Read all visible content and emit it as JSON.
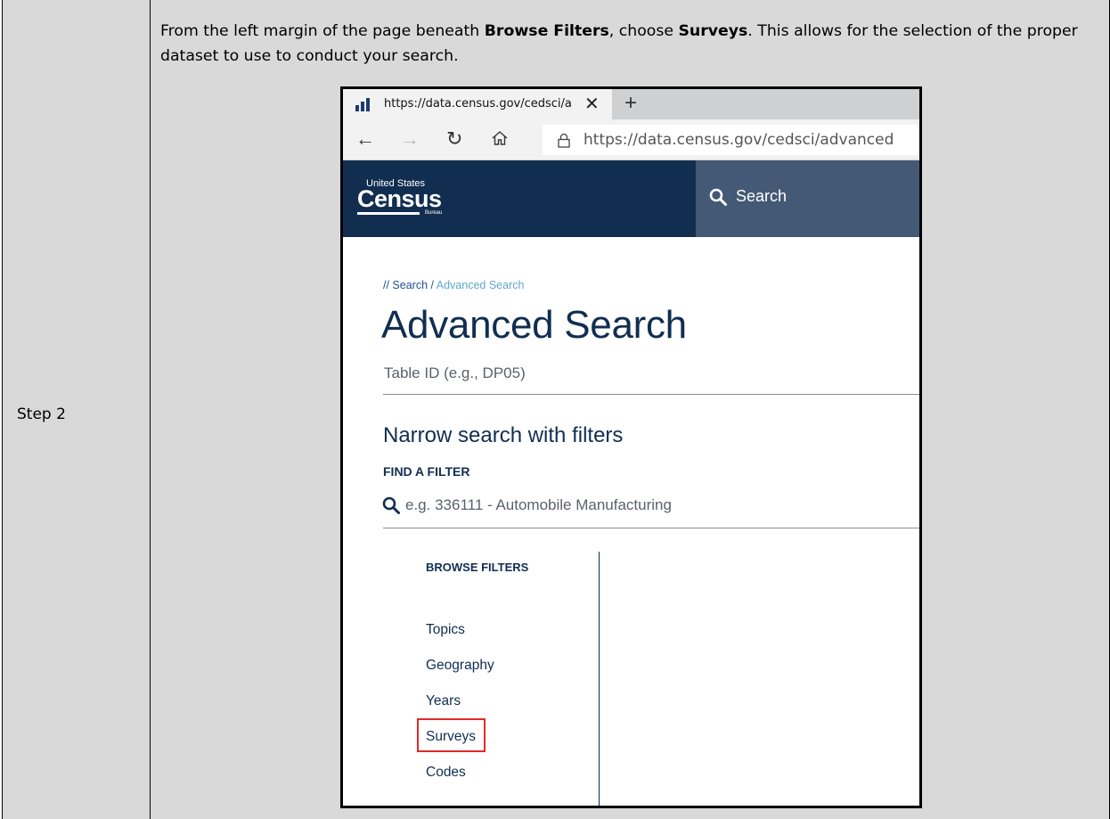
{
  "document": {
    "step_label": "Step 2",
    "instruction": {
      "part1": "From the left margin of the page beneath ",
      "bold1": "Browse Filters",
      "part2": ", choose ",
      "bold2": "Surveys",
      "part3": ". This allows for the selection of the proper dataset to use to conduct your search."
    }
  },
  "browser": {
    "tab": {
      "title": "https://data.census.gov/cedsci/a",
      "close_glyph": "✕",
      "favicon": "census-bar-icon"
    },
    "new_tab_glyph": "+",
    "nav": {
      "back_glyph": "←",
      "forward_glyph": "→",
      "refresh_glyph": "↻",
      "home_glyph": "⌂"
    },
    "url": {
      "host": "https://data.census.gov",
      "path": "/cedsci/advanced"
    }
  },
  "census": {
    "logo": {
      "top": "United States",
      "main": "Census",
      "bottom": "Bureau"
    },
    "header_search_label": "Search",
    "colors": {
      "header_bg": "#112e51",
      "search_bg": "#445975",
      "highlight": "#e02a2a"
    }
  },
  "page": {
    "breadcrumb": {
      "prefix": "// ",
      "link": "Search",
      "separator": " / ",
      "current": "Advanced Search"
    },
    "title": "Advanced Search",
    "table_id_placeholder": "Table ID (e.g., DP05)",
    "narrow_heading": "Narrow search with filters",
    "find_filter_label": "FIND A FILTER",
    "filter_placeholder": "e.g. 336111 - Automobile Manufacturing",
    "browse_filters_heading": "BROWSE FILTERS",
    "browse_filters": [
      "Topics",
      "Geography",
      "Years",
      "Surveys",
      "Codes"
    ],
    "highlighted_filter": "Surveys"
  }
}
